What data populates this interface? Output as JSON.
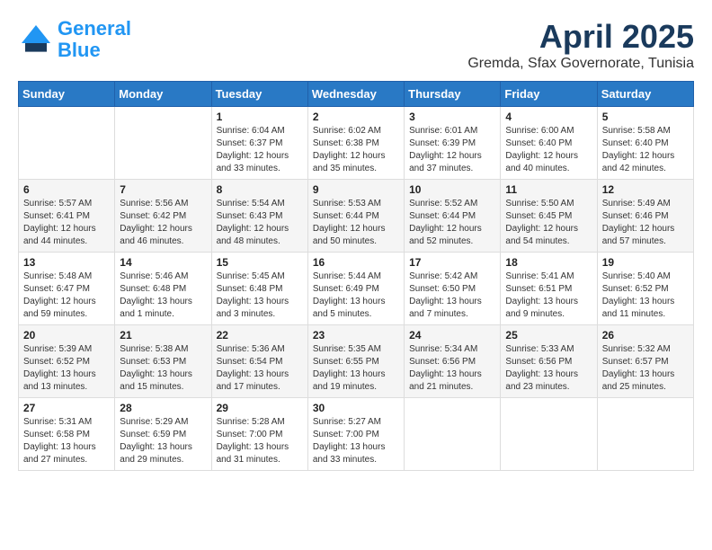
{
  "header": {
    "logo_line1": "General",
    "logo_line2": "Blue",
    "month": "April 2025",
    "location": "Gremda, Sfax Governorate, Tunisia"
  },
  "columns": [
    "Sunday",
    "Monday",
    "Tuesday",
    "Wednesday",
    "Thursday",
    "Friday",
    "Saturday"
  ],
  "weeks": [
    [
      {
        "day": "",
        "sunrise": "",
        "sunset": "",
        "daylight": ""
      },
      {
        "day": "",
        "sunrise": "",
        "sunset": "",
        "daylight": ""
      },
      {
        "day": "1",
        "sunrise": "Sunrise: 6:04 AM",
        "sunset": "Sunset: 6:37 PM",
        "daylight": "Daylight: 12 hours and 33 minutes."
      },
      {
        "day": "2",
        "sunrise": "Sunrise: 6:02 AM",
        "sunset": "Sunset: 6:38 PM",
        "daylight": "Daylight: 12 hours and 35 minutes."
      },
      {
        "day": "3",
        "sunrise": "Sunrise: 6:01 AM",
        "sunset": "Sunset: 6:39 PM",
        "daylight": "Daylight: 12 hours and 37 minutes."
      },
      {
        "day": "4",
        "sunrise": "Sunrise: 6:00 AM",
        "sunset": "Sunset: 6:40 PM",
        "daylight": "Daylight: 12 hours and 40 minutes."
      },
      {
        "day": "5",
        "sunrise": "Sunrise: 5:58 AM",
        "sunset": "Sunset: 6:40 PM",
        "daylight": "Daylight: 12 hours and 42 minutes."
      }
    ],
    [
      {
        "day": "6",
        "sunrise": "Sunrise: 5:57 AM",
        "sunset": "Sunset: 6:41 PM",
        "daylight": "Daylight: 12 hours and 44 minutes."
      },
      {
        "day": "7",
        "sunrise": "Sunrise: 5:56 AM",
        "sunset": "Sunset: 6:42 PM",
        "daylight": "Daylight: 12 hours and 46 minutes."
      },
      {
        "day": "8",
        "sunrise": "Sunrise: 5:54 AM",
        "sunset": "Sunset: 6:43 PM",
        "daylight": "Daylight: 12 hours and 48 minutes."
      },
      {
        "day": "9",
        "sunrise": "Sunrise: 5:53 AM",
        "sunset": "Sunset: 6:44 PM",
        "daylight": "Daylight: 12 hours and 50 minutes."
      },
      {
        "day": "10",
        "sunrise": "Sunrise: 5:52 AM",
        "sunset": "Sunset: 6:44 PM",
        "daylight": "Daylight: 12 hours and 52 minutes."
      },
      {
        "day": "11",
        "sunrise": "Sunrise: 5:50 AM",
        "sunset": "Sunset: 6:45 PM",
        "daylight": "Daylight: 12 hours and 54 minutes."
      },
      {
        "day": "12",
        "sunrise": "Sunrise: 5:49 AM",
        "sunset": "Sunset: 6:46 PM",
        "daylight": "Daylight: 12 hours and 57 minutes."
      }
    ],
    [
      {
        "day": "13",
        "sunrise": "Sunrise: 5:48 AM",
        "sunset": "Sunset: 6:47 PM",
        "daylight": "Daylight: 12 hours and 59 minutes."
      },
      {
        "day": "14",
        "sunrise": "Sunrise: 5:46 AM",
        "sunset": "Sunset: 6:48 PM",
        "daylight": "Daylight: 13 hours and 1 minute."
      },
      {
        "day": "15",
        "sunrise": "Sunrise: 5:45 AM",
        "sunset": "Sunset: 6:48 PM",
        "daylight": "Daylight: 13 hours and 3 minutes."
      },
      {
        "day": "16",
        "sunrise": "Sunrise: 5:44 AM",
        "sunset": "Sunset: 6:49 PM",
        "daylight": "Daylight: 13 hours and 5 minutes."
      },
      {
        "day": "17",
        "sunrise": "Sunrise: 5:42 AM",
        "sunset": "Sunset: 6:50 PM",
        "daylight": "Daylight: 13 hours and 7 minutes."
      },
      {
        "day": "18",
        "sunrise": "Sunrise: 5:41 AM",
        "sunset": "Sunset: 6:51 PM",
        "daylight": "Daylight: 13 hours and 9 minutes."
      },
      {
        "day": "19",
        "sunrise": "Sunrise: 5:40 AM",
        "sunset": "Sunset: 6:52 PM",
        "daylight": "Daylight: 13 hours and 11 minutes."
      }
    ],
    [
      {
        "day": "20",
        "sunrise": "Sunrise: 5:39 AM",
        "sunset": "Sunset: 6:52 PM",
        "daylight": "Daylight: 13 hours and 13 minutes."
      },
      {
        "day": "21",
        "sunrise": "Sunrise: 5:38 AM",
        "sunset": "Sunset: 6:53 PM",
        "daylight": "Daylight: 13 hours and 15 minutes."
      },
      {
        "day": "22",
        "sunrise": "Sunrise: 5:36 AM",
        "sunset": "Sunset: 6:54 PM",
        "daylight": "Daylight: 13 hours and 17 minutes."
      },
      {
        "day": "23",
        "sunrise": "Sunrise: 5:35 AM",
        "sunset": "Sunset: 6:55 PM",
        "daylight": "Daylight: 13 hours and 19 minutes."
      },
      {
        "day": "24",
        "sunrise": "Sunrise: 5:34 AM",
        "sunset": "Sunset: 6:56 PM",
        "daylight": "Daylight: 13 hours and 21 minutes."
      },
      {
        "day": "25",
        "sunrise": "Sunrise: 5:33 AM",
        "sunset": "Sunset: 6:56 PM",
        "daylight": "Daylight: 13 hours and 23 minutes."
      },
      {
        "day": "26",
        "sunrise": "Sunrise: 5:32 AM",
        "sunset": "Sunset: 6:57 PM",
        "daylight": "Daylight: 13 hours and 25 minutes."
      }
    ],
    [
      {
        "day": "27",
        "sunrise": "Sunrise: 5:31 AM",
        "sunset": "Sunset: 6:58 PM",
        "daylight": "Daylight: 13 hours and 27 minutes."
      },
      {
        "day": "28",
        "sunrise": "Sunrise: 5:29 AM",
        "sunset": "Sunset: 6:59 PM",
        "daylight": "Daylight: 13 hours and 29 minutes."
      },
      {
        "day": "29",
        "sunrise": "Sunrise: 5:28 AM",
        "sunset": "Sunset: 7:00 PM",
        "daylight": "Daylight: 13 hours and 31 minutes."
      },
      {
        "day": "30",
        "sunrise": "Sunrise: 5:27 AM",
        "sunset": "Sunset: 7:00 PM",
        "daylight": "Daylight: 13 hours and 33 minutes."
      },
      {
        "day": "",
        "sunrise": "",
        "sunset": "",
        "daylight": ""
      },
      {
        "day": "",
        "sunrise": "",
        "sunset": "",
        "daylight": ""
      },
      {
        "day": "",
        "sunrise": "",
        "sunset": "",
        "daylight": ""
      }
    ]
  ]
}
